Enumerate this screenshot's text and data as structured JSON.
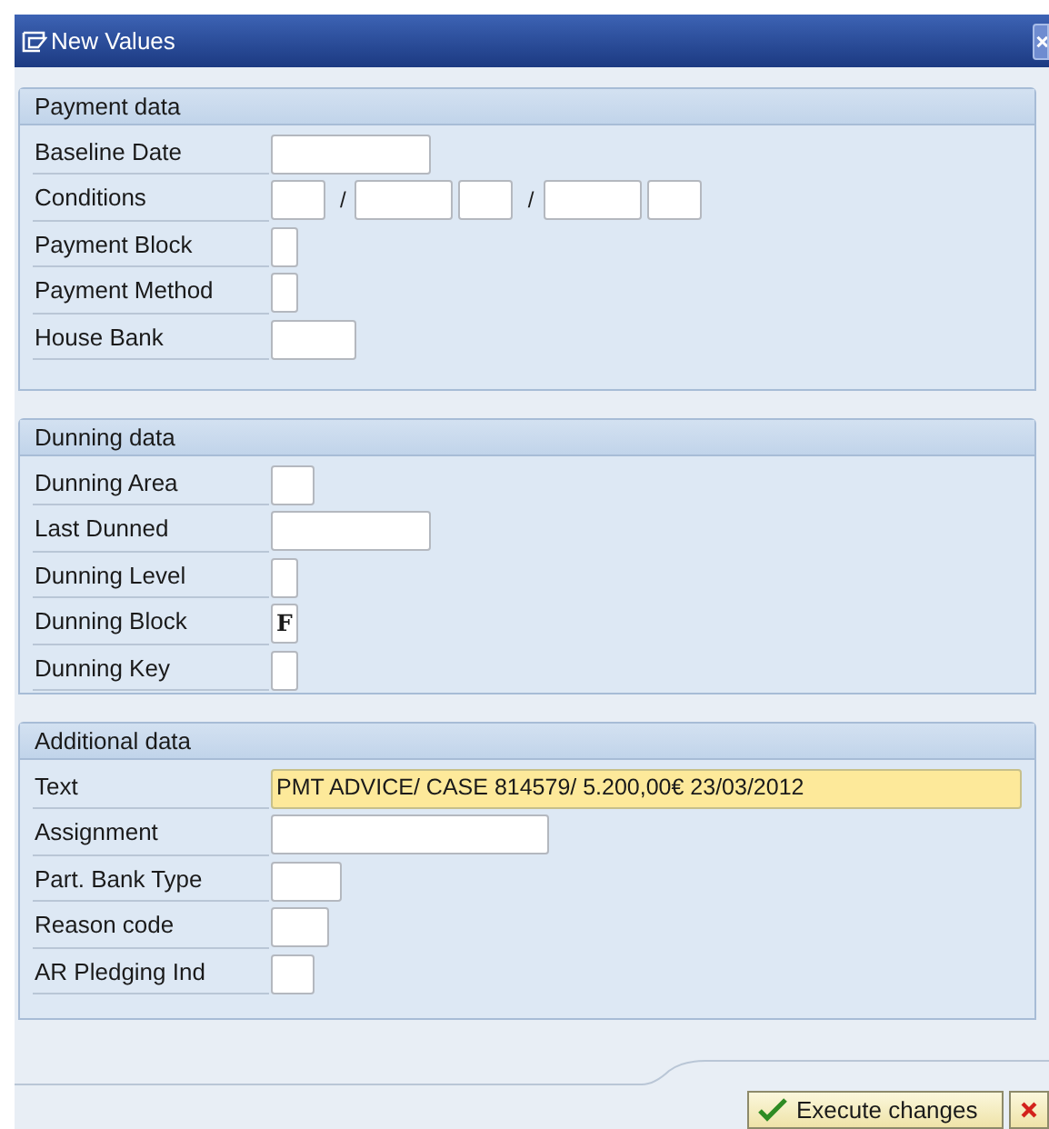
{
  "window": {
    "title": "New Values"
  },
  "groups": [
    {
      "title": "Payment data",
      "rows": [
        {
          "label": "Baseline Date",
          "fields": [
            {
              "kind": "input"
            }
          ]
        },
        {
          "label": "Conditions",
          "fields": [
            {
              "kind": "input"
            },
            {
              "kind": "separator",
              "text": "/"
            },
            {
              "kind": "input"
            },
            {
              "kind": "input"
            },
            {
              "kind": "separator",
              "text": "/"
            },
            {
              "kind": "input"
            },
            {
              "kind": "input"
            }
          ]
        },
        {
          "label": "Payment Block",
          "fields": [
            {
              "kind": "input"
            }
          ]
        },
        {
          "label": "Payment Method",
          "fields": [
            {
              "kind": "input"
            }
          ]
        },
        {
          "label": "House Bank",
          "fields": [
            {
              "kind": "input"
            }
          ]
        }
      ]
    },
    {
      "title": "Dunning data",
      "rows": [
        {
          "label": "Dunning Area",
          "fields": [
            {
              "kind": "input"
            }
          ]
        },
        {
          "label": "Last Dunned",
          "fields": [
            {
              "kind": "input"
            }
          ]
        },
        {
          "label": "Dunning Level",
          "fields": [
            {
              "kind": "input"
            }
          ]
        },
        {
          "label": "Dunning Block",
          "fields": [
            {
              "kind": "input",
              "value": "F"
            }
          ]
        },
        {
          "label": "Dunning Key",
          "fields": [
            {
              "kind": "input"
            }
          ]
        }
      ]
    },
    {
      "title": "Additional data",
      "rows": [
        {
          "label": "Text",
          "fields": [
            {
              "kind": "input",
              "value": "PMT ADVICE/ CASE 814579/ 5.200,00€ 23/03/2012",
              "highlighted": true
            }
          ]
        },
        {
          "label": "Assignment",
          "fields": [
            {
              "kind": "input"
            }
          ]
        },
        {
          "label": "Part. Bank Type",
          "fields": [
            {
              "kind": "input"
            }
          ]
        },
        {
          "label": "Reason code",
          "fields": [
            {
              "kind": "input"
            }
          ]
        },
        {
          "label": "AR Pledging Ind",
          "fields": [
            {
              "kind": "input"
            }
          ]
        }
      ]
    }
  ],
  "buttons": [
    {
      "label": "Execute changes",
      "kind": "execute"
    },
    {
      "kind": "cancel"
    }
  ]
}
